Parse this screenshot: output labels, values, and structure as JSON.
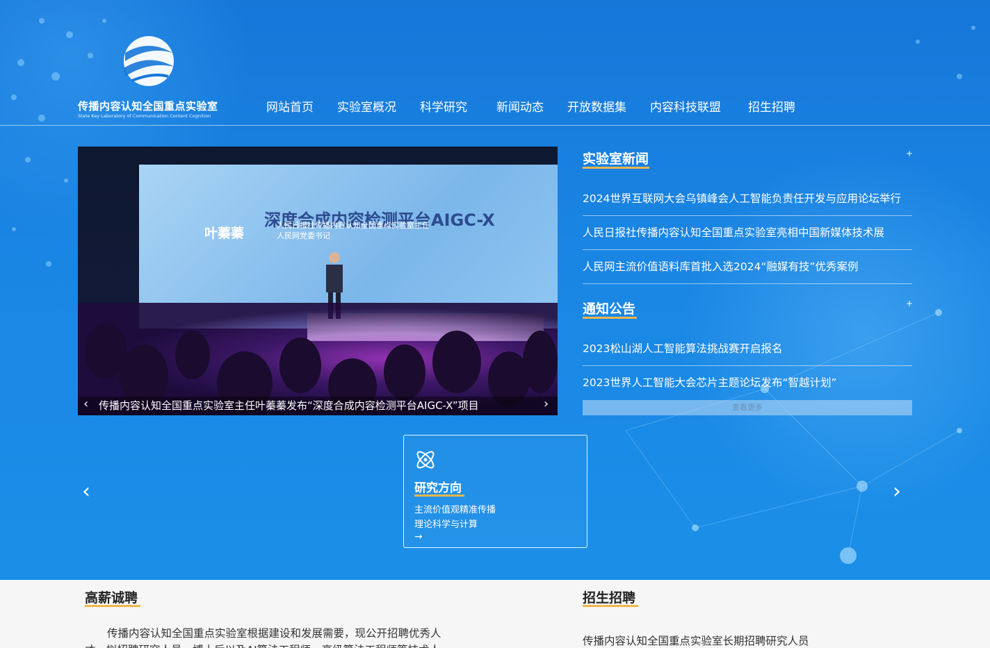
{
  "site": {
    "logo_title": "传播内容认知全国重点实验室",
    "logo_subtitle": "State Key Laboratory of Communication Content Cognition"
  },
  "nav": {
    "items": [
      {
        "label": "网站首页"
      },
      {
        "label": "实验室概况"
      },
      {
        "label": "科学研究"
      },
      {
        "label": "新闻动态"
      },
      {
        "label": "开放数据集"
      },
      {
        "label": "内容科技联盟"
      },
      {
        "label": "招生招聘"
      }
    ]
  },
  "slider": {
    "screen_title": "深度合成内容检测平台AIGC-X",
    "person_name": "叶蓁蓁",
    "person_title_1": "人民日报社传播内容认知全国重点实验室主任",
    "person_title_2": "人民网党委书记",
    "caption": "传播内容认知全国重点实验室主任叶蓁蓁发布“深度合成内容检测平台AIGC-X”项目",
    "prev": "‹",
    "next": "›"
  },
  "lab_news": {
    "title": "实验室新闻",
    "more": "+",
    "items": [
      "2024世界互联网大会乌镇峰会人工智能负责任开发与应用论坛举行",
      "人民日报社传播内容认知全国重点实验室亮相中国新媒体技术展",
      "人民网主流价值语料库首批入选2024“融媒有技”优秀案例"
    ]
  },
  "notices": {
    "title": "通知公告",
    "more": "+",
    "items": [
      "2023松山湖人工智能算法挑战赛开启报名",
      "2023世界人工智能大会芯片主题论坛发布“智越计划”"
    ],
    "view_more": "查看更多"
  },
  "research": {
    "title": "研究方向",
    "line1": "主流价值观精准传播",
    "line2": "理论科学与计算",
    "arrow": "→",
    "prev": "‹",
    "next": "›"
  },
  "recruit": {
    "title": "高薪诚聘",
    "text": "传播内容认知全国重点实验室根据建设和发展需要，现公开招聘优秀人才，拟招聘研究人员、博士后以及AI算法工程师、高级算法工程师等技术人"
  },
  "admissions": {
    "title": "招生招聘",
    "link": "传播内容认知全国重点实验室长期招聘研究人员"
  },
  "colors": {
    "accent": "#f0b64a",
    "hero_blue": "#1a86e4"
  }
}
